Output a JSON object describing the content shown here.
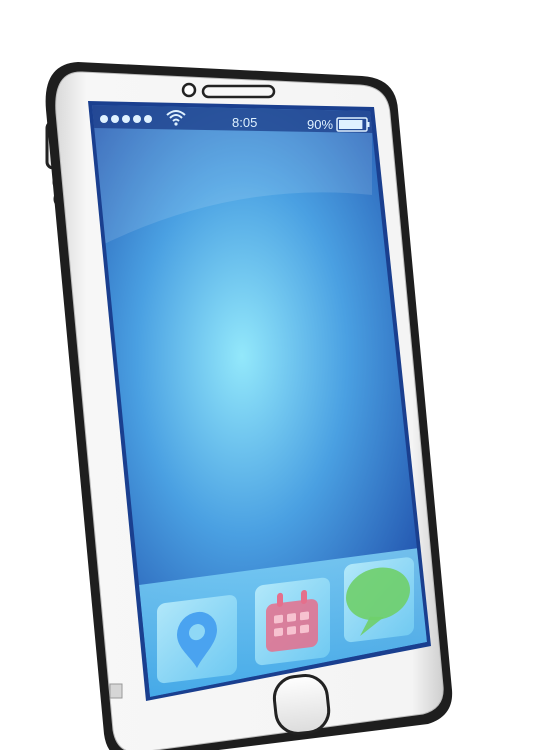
{
  "status_bar": {
    "signal_dots": 5,
    "wifi_icon": "wifi-icon",
    "time": "8:05",
    "battery_percent": "90%",
    "battery_level": 0.9
  },
  "dock": {
    "apps": [
      {
        "icon": "map-pin-icon",
        "color": "#4aa3f0"
      },
      {
        "icon": "calendar-icon",
        "color": "#e86a8a"
      },
      {
        "icon": "message-bubble-icon",
        "color": "#6fcf6a"
      }
    ]
  },
  "colors": {
    "frame": "#222222",
    "body": "#f2f2f2",
    "screen_light": "#8fe6fb",
    "screen_dark": "#1b4aa6"
  }
}
